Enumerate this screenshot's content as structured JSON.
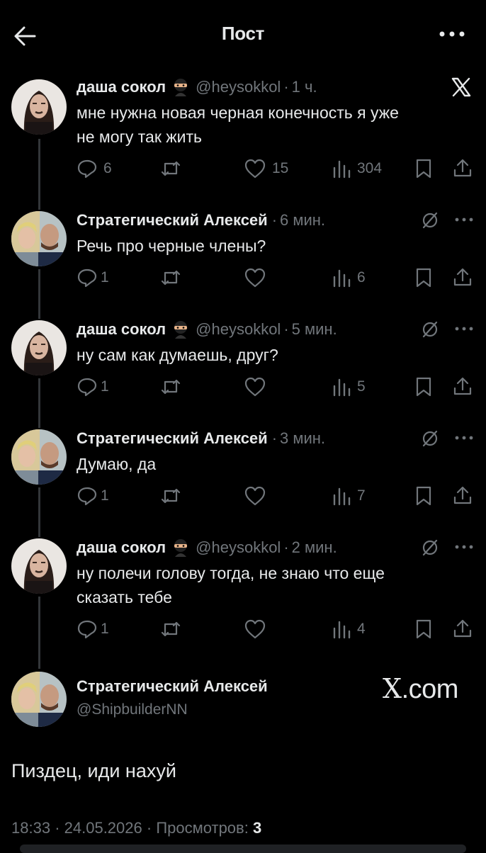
{
  "header": {
    "title": "Пост",
    "back_icon": "arrow-left-icon",
    "more_icon": "more-horizontal-icon"
  },
  "tweets": [
    {
      "name": "даша сокол",
      "handle": "@heysokkol",
      "sep": "·",
      "time": "1 ч.",
      "text": "мне нужна новая черная конечность я уже\nне могу так жить",
      "replies": "6",
      "retweets": "",
      "likes": "15",
      "views": "304"
    },
    {
      "name": "Стратегический Алексей",
      "handle": "",
      "sep": "·",
      "time": "6 мин.",
      "text": "Речь про черные члены?",
      "replies": "1",
      "retweets": "",
      "likes": "",
      "views": "6"
    },
    {
      "name": "даша сокол",
      "handle": "@heysokkol",
      "sep": "·",
      "time": "5 мин.",
      "text": "ну сам как думаешь, друг?",
      "replies": "1",
      "retweets": "",
      "likes": "",
      "views": "5"
    },
    {
      "name": "Стратегический Алексей",
      "handle": "",
      "sep": "·",
      "time": "3 мин.",
      "text": "Думаю, да",
      "replies": "1",
      "retweets": "",
      "likes": "",
      "views": "7"
    },
    {
      "name": "даша сокол",
      "handle": "@heysokkol",
      "sep": "·",
      "time": "2 мин.",
      "text": "ну полечи голову тогда, не знаю что еще\nсказать тебе",
      "replies": "1",
      "retweets": "",
      "likes": "",
      "views": "4"
    }
  ],
  "main_post": {
    "name": "Стратегический Алексей",
    "handle": "@ShipbuilderNN",
    "brand_x": "X",
    "brand_suffix": ".com",
    "text": "Пиздец, иди нахуй",
    "time": "18:33",
    "date": "24.05.2026",
    "views_label": "Просмотров:",
    "views": "3",
    "sep": "·"
  },
  "colors": {
    "background": "#000000",
    "text": "#e7e9ea",
    "muted": "#71767b",
    "thread_line": "#333639"
  }
}
